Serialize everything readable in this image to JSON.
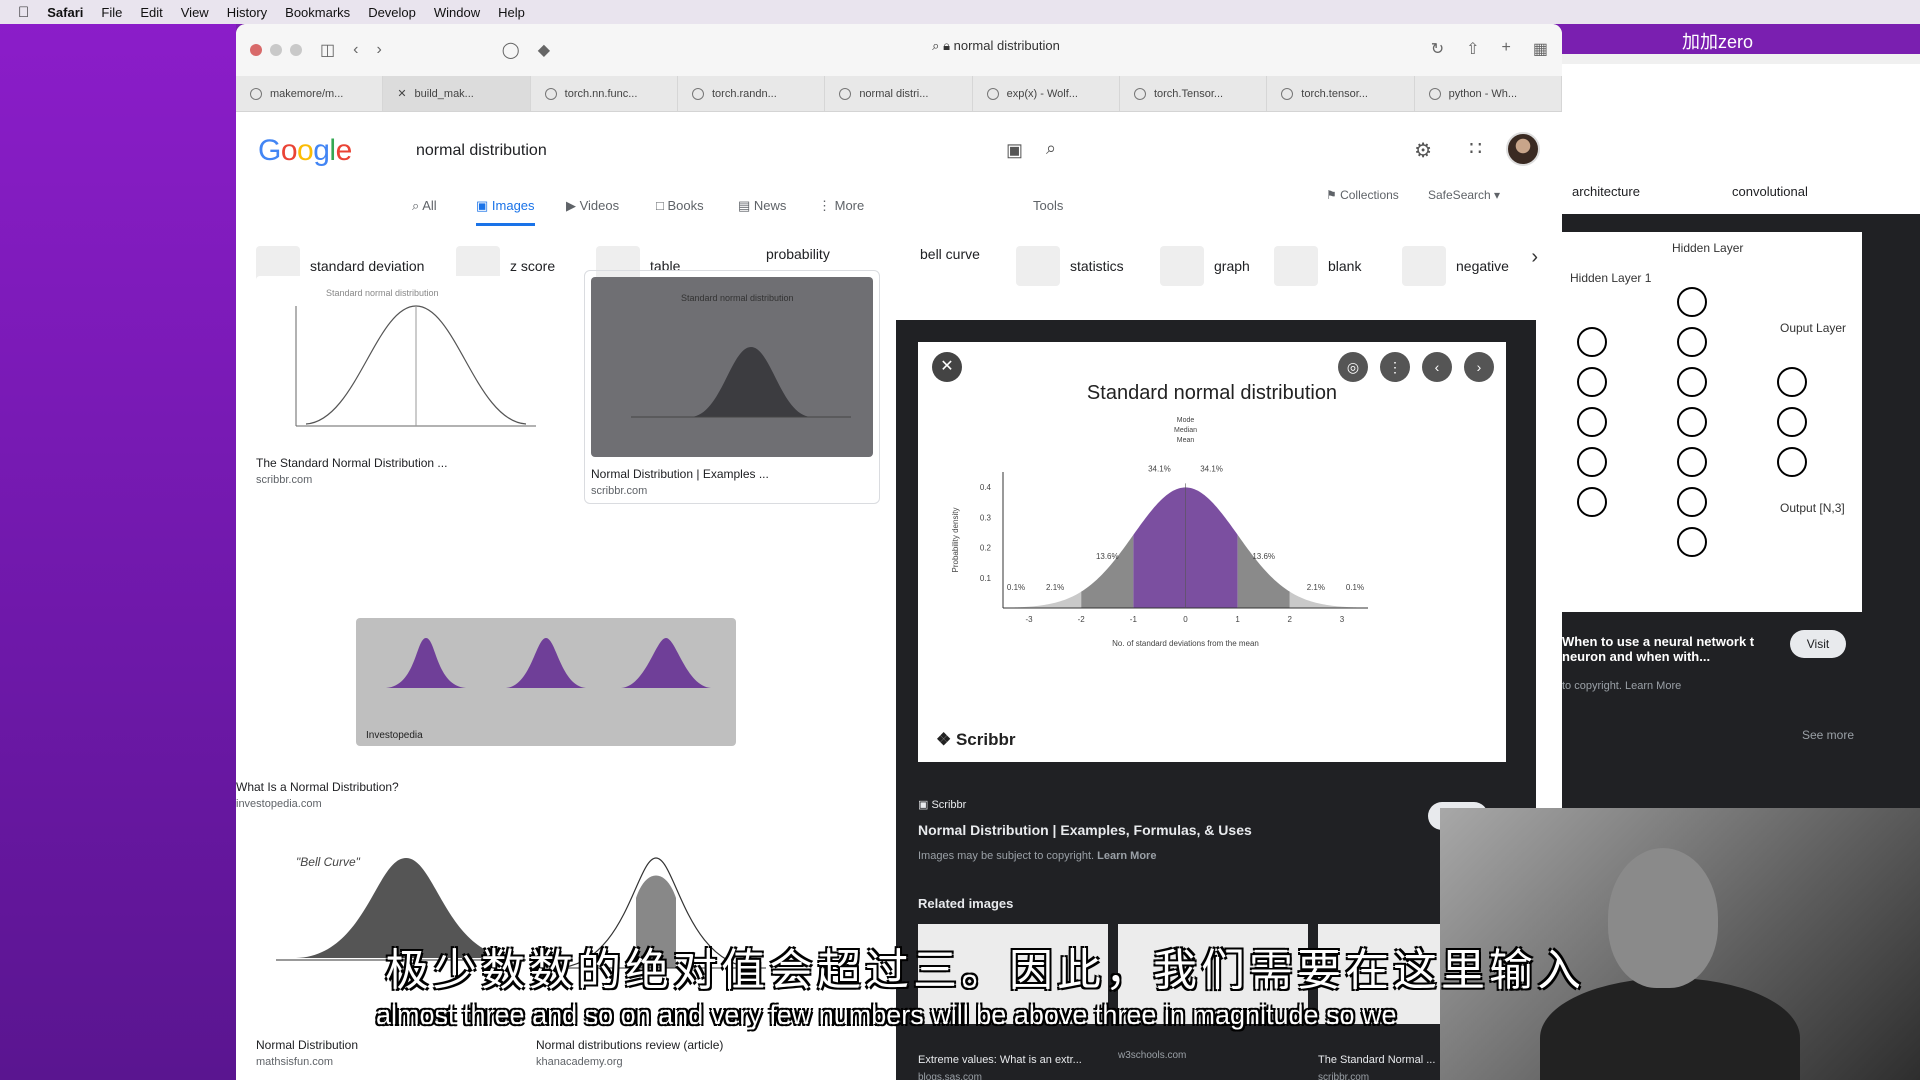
{
  "menubar": {
    "items": [
      "Safari",
      "File",
      "Edit",
      "View",
      "History",
      "Bookmarks",
      "Develop",
      "Window",
      "Help"
    ]
  },
  "browser": {
    "address": "normal distribution",
    "tabs": [
      {
        "label": "makemore/m..."
      },
      {
        "label": "build_mak..."
      },
      {
        "label": "torch.nn.func..."
      },
      {
        "label": "torch.randn..."
      },
      {
        "label": "normal distri..."
      },
      {
        "label": "exp(x) - Wolf..."
      },
      {
        "label": "torch.Tensor..."
      },
      {
        "label": "torch.tensor..."
      },
      {
        "label": "python - Wh..."
      }
    ]
  },
  "google": {
    "logo": "Google",
    "query": "normal distribution",
    "nav": [
      "All",
      "Images",
      "Videos",
      "Books",
      "News",
      "More"
    ],
    "tools": "Tools",
    "collections": "Collections",
    "safesearch": "SafeSearch",
    "chips": [
      "standard deviation",
      "z score",
      "table",
      "probability",
      "bell curve",
      "statistics",
      "graph",
      "blank",
      "negative"
    ]
  },
  "results": [
    {
      "title": "The Standard Normal Distribution ...",
      "source": "scribbr.com",
      "image_caption": "Standard normal distribution"
    },
    {
      "title": "Normal Distribution | Examples ...",
      "source": "scribbr.com",
      "image_caption": "Standard normal distribution"
    },
    {
      "title": "What Is a Normal Distribution?",
      "source": "investopedia.com",
      "image_caption": "Investopedia"
    },
    {
      "title": "Normal Distribution",
      "source": "mathsisfun.com",
      "image_caption": "\"Bell Curve\""
    },
    {
      "title": "Normal distributions review (article)",
      "source": "khanacademy.org"
    }
  ],
  "preview": {
    "title": "Standard normal distribution",
    "annotation": [
      "Mode",
      "Median",
      "Mean"
    ],
    "y_label": "Probability density",
    "x_label": "No. of standard deviations from the mean",
    "brand": "Scribbr",
    "source": "Scribbr",
    "page_title": "Normal Distribution | Examples, Formulas, & Uses",
    "copyright": "Images may be subject to copyright.",
    "learn_more": "Learn More",
    "visit": "Visit",
    "related_heading": "Related images",
    "related": [
      {
        "caption": "Extreme values: What is an extr...",
        "source": "blogs.sas.com"
      },
      {
        "caption": "",
        "source": "w3schools.com"
      },
      {
        "caption": "The Standard Normal ...",
        "source": "scribbr.com"
      }
    ]
  },
  "chart_data": {
    "type": "area",
    "title": "Standard normal distribution",
    "xlabel": "No. of standard deviations from the mean",
    "ylabel": "Probability density",
    "x_ticks": [
      -3,
      -2,
      -1,
      0,
      1,
      2,
      3
    ],
    "y_ticks": [
      0.1,
      0.2,
      0.3,
      0.4
    ],
    "xlim": [
      -3.5,
      3.5
    ],
    "ylim": [
      0,
      0.45
    ],
    "regions": [
      {
        "range": [
          -4,
          -3
        ],
        "percent": "0.1%"
      },
      {
        "range": [
          -3,
          -2
        ],
        "percent": "2.1%"
      },
      {
        "range": [
          -2,
          -1
        ],
        "percent": "13.6%"
      },
      {
        "range": [
          -1,
          0
        ],
        "percent": "34.1%"
      },
      {
        "range": [
          0,
          1
        ],
        "percent": "34.1%"
      },
      {
        "range": [
          1,
          2
        ],
        "percent": "13.6%"
      },
      {
        "range": [
          2,
          3
        ],
        "percent": "2.1%"
      },
      {
        "range": [
          3,
          4
        ],
        "percent": "0.1%"
      }
    ],
    "colors": {
      "inner": "#7b4fa0",
      "middle": "#8a8a8a",
      "outer": "#c9c9c9"
    }
  },
  "window2": {
    "chips": [
      "architecture",
      "convolutional"
    ],
    "diagram_labels": [
      "Hidden Layer 1",
      "Hidden Layer",
      "Ouput Layer",
      "Output [N,3]"
    ],
    "caption": "When to use a neural network t neuron and when with...",
    "copyright": "to copyright. Learn More",
    "visit": "Visit",
    "see_more": "See more"
  },
  "subtitles": {
    "zh": "极少数数的绝对值会超过三。因此，我们需要在这里输入",
    "en": "almost three and so on and very few numbers will be above three in magnitude so we"
  }
}
